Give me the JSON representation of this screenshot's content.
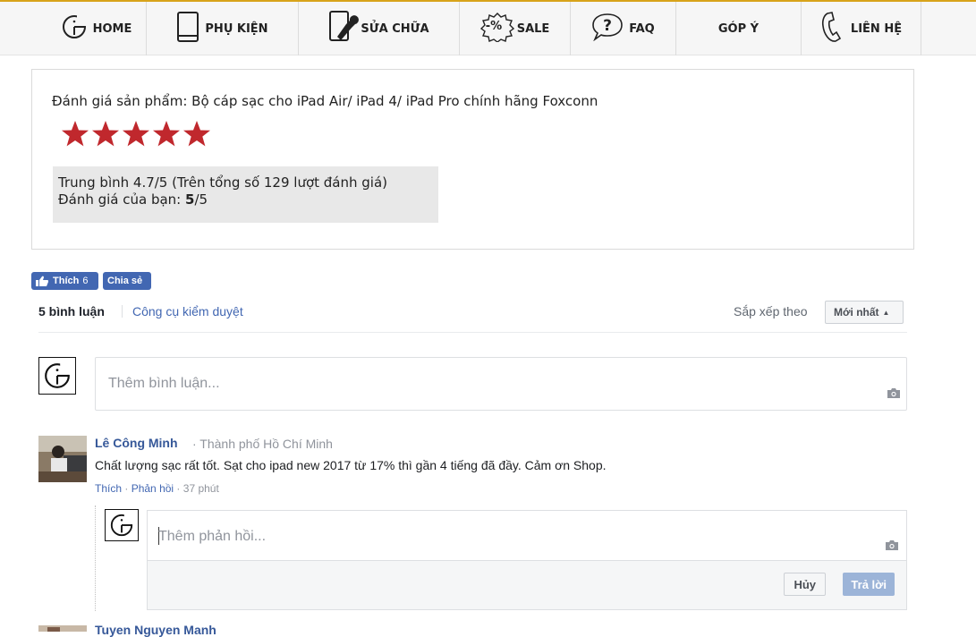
{
  "nav": {
    "home": "HOME",
    "accessories": "PHỤ KIỆN",
    "repair": "SỬA CHỮA",
    "sale": "SALE",
    "sale_badge": "-%",
    "faq": "FAQ",
    "feedback": "GÓP Ý",
    "contact": "LIÊN HỆ",
    "accent_color": "#d8a31a"
  },
  "rating": {
    "title": "Đánh giá sản phẩm: Bộ cáp sạc cho iPad Air/ iPad 4/ iPad Pro chính hãng Foxconn",
    "stars": 5,
    "star_color": "#c0282d",
    "average_line": "Trung bình 4.7/5 (Trên tổng số 129 lượt đánh giá)",
    "your_rating_label": "Đánh giá của bạn: ",
    "your_rating_value": "5",
    "your_rating_suffix": "/5"
  },
  "facebook": {
    "like_label": "Thích",
    "like_count": "6",
    "share_label": "Chia sẻ",
    "comments_count": "5 bình luận",
    "moderation_tools": "Công cụ kiểm duyệt",
    "sort_by": "Sắp xếp theo",
    "sort_value": "Mới nhất",
    "comment_placeholder": "Thêm bình luận...",
    "brand_color": "#4267b2"
  },
  "comments": [
    {
      "author": "Lê Công Minh",
      "location": "· Thành phố Hồ Chí Minh",
      "text": "Chất lượng sạc rất tốt. Sạt cho ipad new 2017 từ 17% thì gần 4 tiếng đã đầy. Cảm ơn Shop.",
      "like": "Thích",
      "reply": "Phản hồi",
      "time": "37 phút"
    },
    {
      "author": "Tuyen Nguyen Manh"
    }
  ],
  "reply": {
    "placeholder": "Thêm phản hồi...",
    "cancel": "Hủy",
    "submit": "Trả lời"
  }
}
